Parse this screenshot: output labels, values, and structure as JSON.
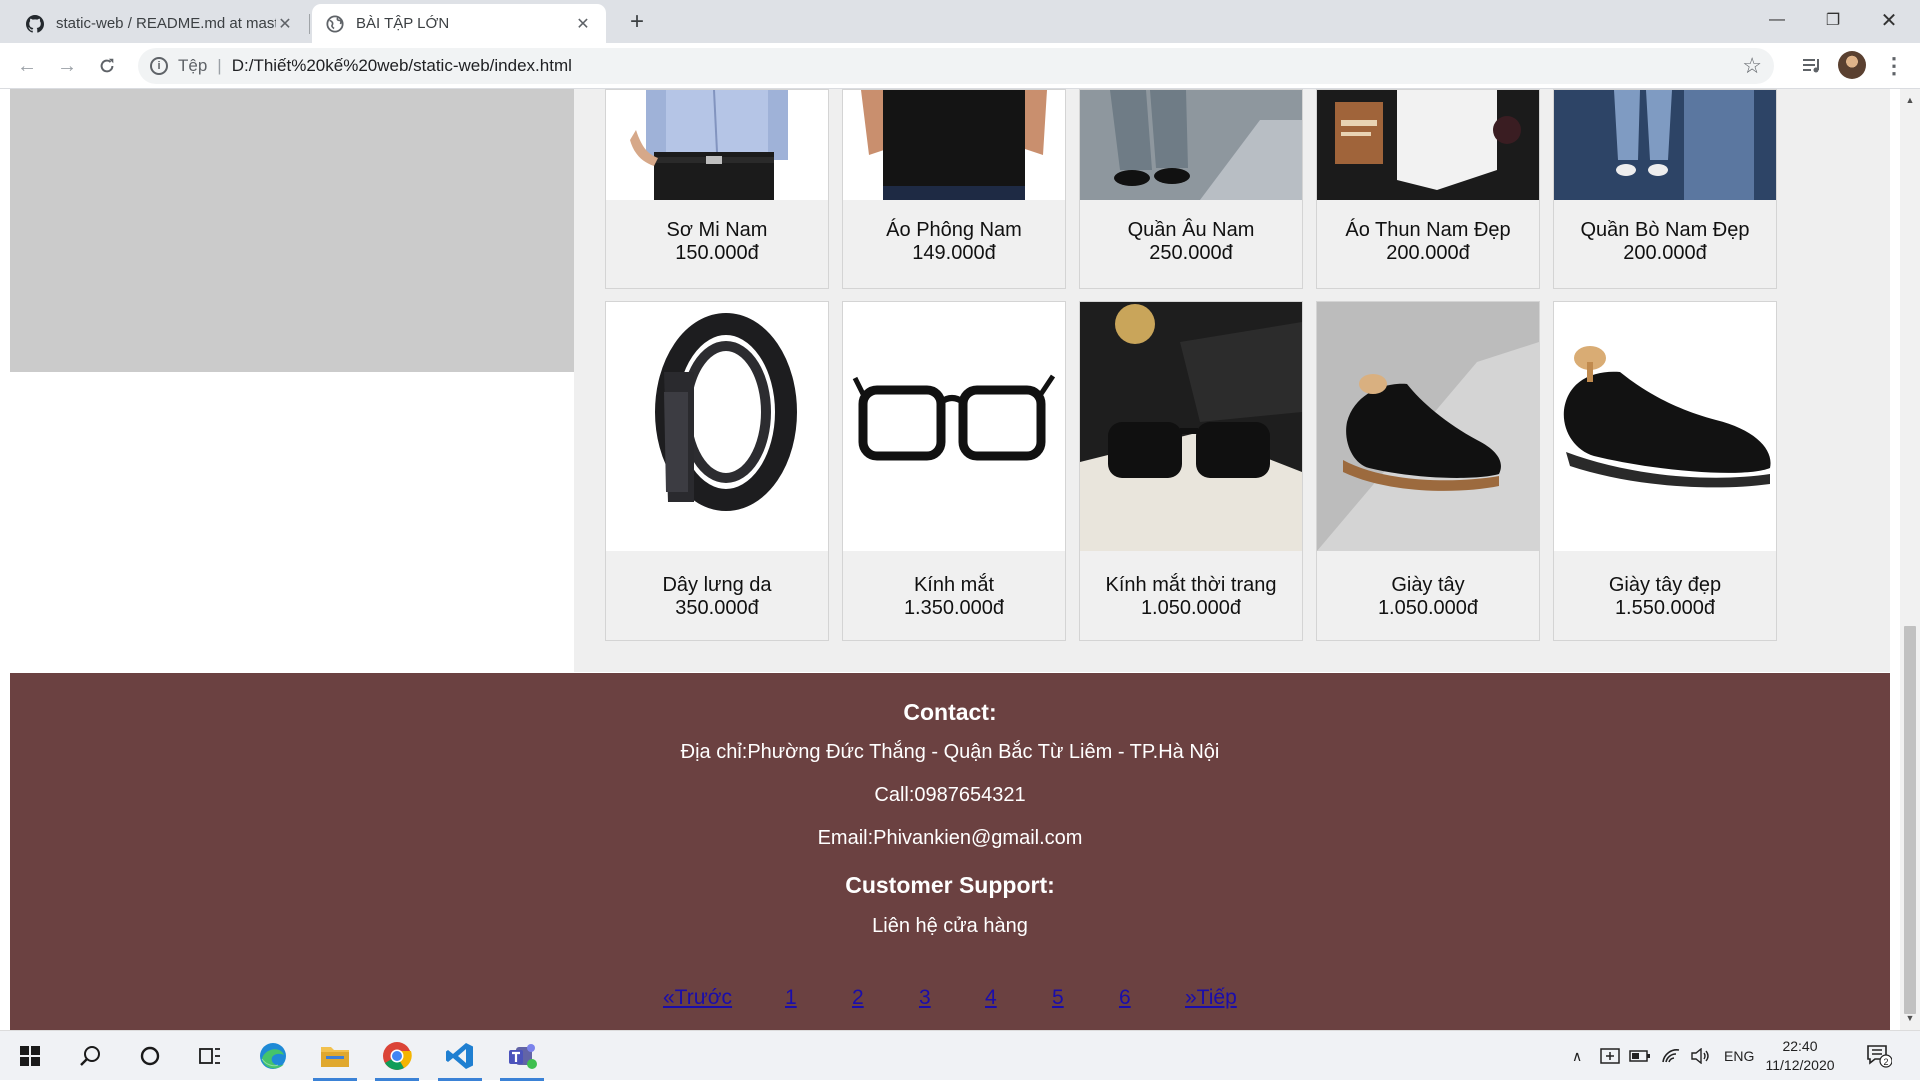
{
  "browser": {
    "tabs": [
      {
        "title": "static-web / README.md at master · phivankien/static-web",
        "active": false
      },
      {
        "title": "BÀI TẬP LỚN",
        "active": true
      }
    ],
    "address": {
      "scheme_label": "Tệp",
      "url": "D:/Thiết%20kế%20web/static-web/index.html"
    }
  },
  "products": [
    {
      "name": "Sơ Mi Nam",
      "price": "150.000đ",
      "image": "shirt"
    },
    {
      "name": "Áo Phông Nam",
      "price": "149.000đ",
      "image": "tshirt"
    },
    {
      "name": "Quần Âu Nam",
      "price": "250.000đ",
      "image": "trousers"
    },
    {
      "name": "Áo Thun Nam Đẹp",
      "price": "200.000đ",
      "image": "folded-tee"
    },
    {
      "name": "Quần Bò Nam Đẹp",
      "price": "200.000đ",
      "image": "jeans"
    },
    {
      "name": "Dây lưng da",
      "price": "350.000đ",
      "image": "belt"
    },
    {
      "name": "Kính mắt",
      "price": "1.350.000đ",
      "image": "glasses"
    },
    {
      "name": "Kính mắt thời trang",
      "price": "1.050.000đ",
      "image": "sunglasses"
    },
    {
      "name": "Giày tây",
      "price": "1.050.000đ",
      "image": "shoe"
    },
    {
      "name": "Giày tây đẹp",
      "price": "1.550.000đ",
      "image": "shoe"
    }
  ],
  "footer": {
    "contact_heading": "Contact:",
    "address": "Địa chỉ:Phường Đức Thắng - Quận Bắc Từ Liêm - TP.Hà Nội",
    "phone": "Call:0987654321",
    "email": "Email:Phivankien@gmail.com",
    "support_heading": "Customer Support:",
    "support_text": "Liên hệ cửa hàng"
  },
  "pagination": {
    "prev": "«Trước",
    "pages": [
      "1",
      "2",
      "3",
      "4",
      "5",
      "6"
    ],
    "next": "»Tiếp"
  },
  "taskbar": {
    "language": "ENG",
    "time": "22:40",
    "date": "11/12/2020",
    "notification_count": "2"
  },
  "colors": {
    "footer_bg": "#6b4141",
    "link": "#1a0dab",
    "card_bg": "#f0f0f0"
  }
}
